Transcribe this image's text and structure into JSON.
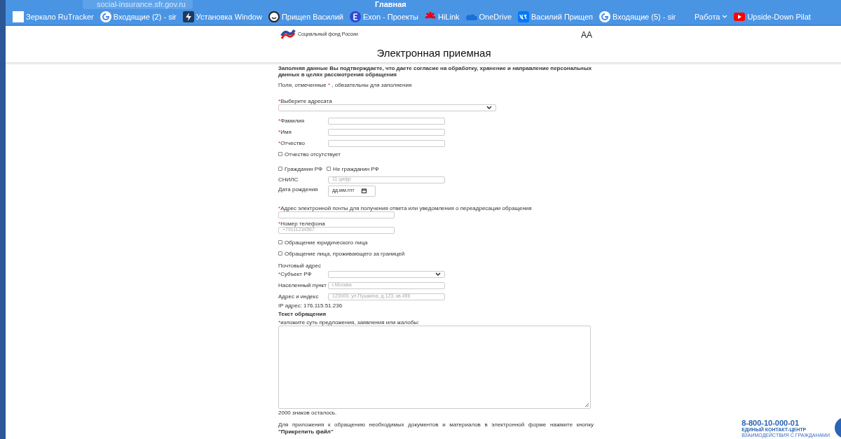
{
  "browser": {
    "address": "social-insurance.sfr.gov.ru",
    "tab_title": "Главная",
    "bookmarks": [
      {
        "label": "Зеркало RuTracker",
        "kind": "site"
      },
      {
        "label": "Входящие (2) - sir",
        "kind": "site"
      },
      {
        "label": "Установка Window",
        "kind": "site"
      },
      {
        "label": "Прищеп Василий",
        "kind": "site"
      },
      {
        "label": "Exon - Проекты",
        "kind": "site"
      },
      {
        "label": "HiLink",
        "kind": "site"
      },
      {
        "label": "OneDrive",
        "kind": "site"
      },
      {
        "label": "Василий Прищеп",
        "kind": "site"
      },
      {
        "label": "Входящие (5) - sir",
        "kind": "site"
      },
      {
        "label": "Работа",
        "kind": "folder"
      },
      {
        "label": "Upside-Down Pilat",
        "kind": "site"
      }
    ]
  },
  "header": {
    "logo_text": "Социальный фонд России",
    "font_size_toggle": "АА",
    "title": "Электронная приемная"
  },
  "form": {
    "items": [
      {
        "kind": "note",
        "text": "**Заполняя данные Вы подтверждаете, что даете согласие на обработку, хранение и направление персональных данных в целях рассмотрения обращения**"
      },
      {
        "kind": "required_note",
        "before": "Поля, отмеченные",
        "marker": "*",
        "after": ", обязательны для заполнения"
      },
      {
        "kind": "stacked_select",
        "label": "Выберите адресата",
        "required": true
      },
      {
        "kind": "inline_text",
        "label": "Фамилия",
        "required": true
      },
      {
        "kind": "inline_text",
        "label": "Имя",
        "required": true
      },
      {
        "kind": "inline_text",
        "label": "Отчество",
        "required": true
      },
      {
        "kind": "checkbox",
        "label": "Отчество отсутствует",
        "checked": false
      },
      {
        "kind": "checkbox_pair",
        "options": [
          {
            "label": "Гражданин РФ",
            "checked": false
          },
          {
            "label": "Не гражданин РФ",
            "checked": false
          }
        ]
      },
      {
        "kind": "inline_text",
        "label": "СНИЛС",
        "required": false,
        "placeholder": "11 цифр"
      },
      {
        "kind": "date",
        "label": "Дата рождения",
        "required": false,
        "placeholder": "дд.мм.гггг"
      },
      {
        "kind": "stacked_text",
        "label": "Адрес электронной почты для получения ответа или уведомления о переадресации обращения",
        "required": true
      },
      {
        "kind": "stacked_text",
        "label": "Номер телефона",
        "required": true,
        "placeholder": "+79111234567"
      },
      {
        "kind": "checkbox",
        "label": "Обращение юридического лица",
        "checked": false
      },
      {
        "kind": "checkbox",
        "label": "Обращение лица, проживающего за границей",
        "checked": false
      },
      {
        "kind": "note",
        "text": "Почтовый адрес"
      },
      {
        "kind": "inline_select",
        "label": "Субъект РФ",
        "required": true
      },
      {
        "kind": "inline_text",
        "label": "Населенный пункт",
        "required": false,
        "placeholder": "г.Москва"
      },
      {
        "kind": "inline_text",
        "label": "Адрес и индекс",
        "required": false,
        "placeholder": "123000, ул.Пушкина, д.123, кв.456"
      },
      {
        "kind": "note",
        "text": "IP адрес: 176.115.51.236"
      },
      {
        "kind": "note",
        "text": "**Текст обращения**"
      },
      {
        "kind": "textarea",
        "label": "изложите суть предложения, заявления или жалобы:",
        "required": true
      },
      {
        "kind": "note",
        "text": "2000 знаков осталось."
      },
      {
        "kind": "paragraph",
        "text": "Для приложения к обращению необходимых документов и материалов в электронной форме нажмите кнопку **\"Прикрепить файл\"**"
      }
    ]
  },
  "contact": {
    "phone": "8-800-10-000-01",
    "line1": "ЕДИНЫЙ КОНТАКТ-ЦЕНТР",
    "line2": "ВЗАИМОДЕЙСТВИЯ С ГРАЖДАНАМИ"
  }
}
